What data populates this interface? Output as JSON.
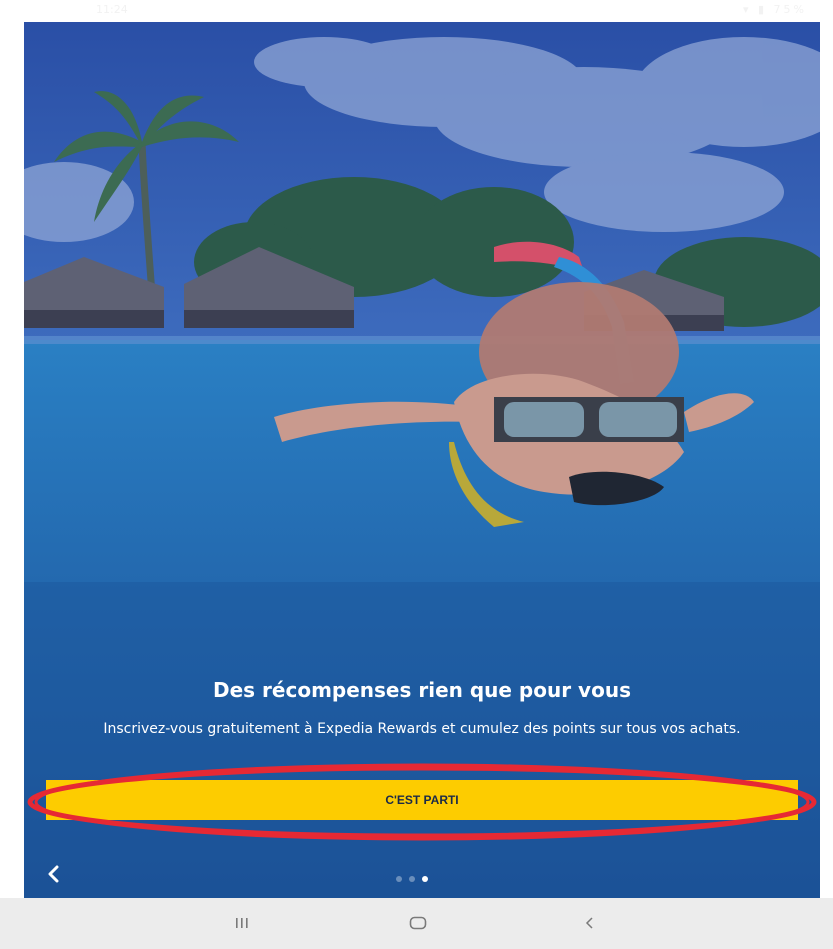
{
  "status_bar": {
    "time": "11:24",
    "indicators": "▾ ▮ 75%"
  },
  "onboarding": {
    "headline": "Des récompenses rien que pour vous",
    "subtitle": "Inscrivez-vous gratuitement à Expedia Rewards et cumulez des points sur tous vos achats.",
    "cta_label": "C'EST PARTI",
    "pager": {
      "count": 3,
      "active_index": 2
    }
  },
  "colors": {
    "ocean": "#1f5a9c",
    "cta": "#fdcc00",
    "highlight": "#e62934"
  },
  "icons": {
    "back": "chevron-left-icon",
    "nav_recents": "recents-icon",
    "nav_home": "home-icon",
    "nav_back": "back-icon"
  }
}
